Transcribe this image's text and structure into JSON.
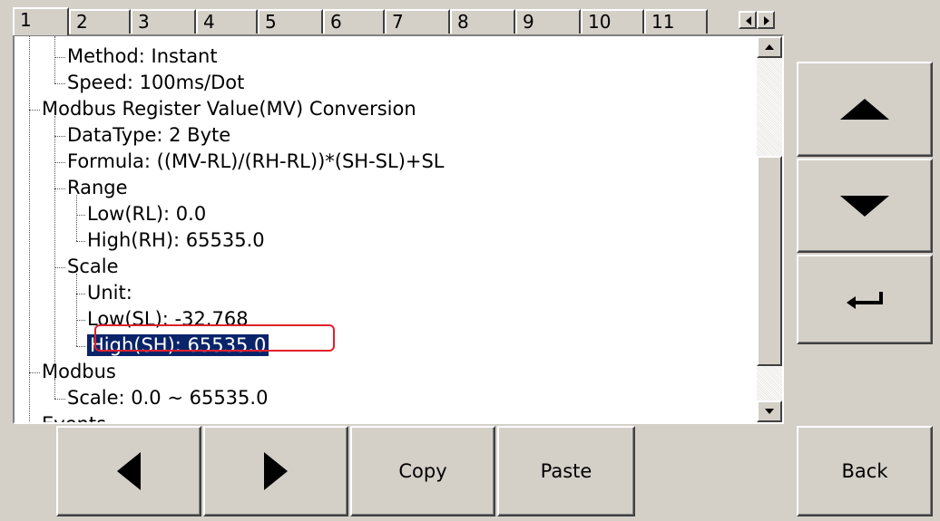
{
  "tabs": [
    "1",
    "2",
    "3",
    "4",
    "5",
    "6",
    "7",
    "8",
    "9",
    "10",
    "11"
  ],
  "tree": [
    {
      "text": "Method: Instant",
      "level": 1
    },
    {
      "text": "Speed: 100ms/Dot",
      "level": 1
    },
    {
      "text": "Modbus Register Value(MV) Conversion",
      "level": 0
    },
    {
      "text": "DataType: 2 Byte",
      "level": 1
    },
    {
      "text": "Formula: ((MV-RL)/(RH-RL))*(SH-SL)+SL",
      "level": 1
    },
    {
      "text": "Range",
      "level": 1
    },
    {
      "text": "Low(RL): 0.0",
      "level": 2
    },
    {
      "text": "High(RH): 65535.0",
      "level": 2
    },
    {
      "text": "Scale",
      "level": 1
    },
    {
      "text": "Unit:",
      "level": 2
    },
    {
      "text": "Low(SL): -32.768",
      "level": 2
    },
    {
      "text": "High(SH): 65535.0",
      "level": 2,
      "selected": true
    },
    {
      "text": "Modbus",
      "level": 0
    },
    {
      "text": "Scale: 0.0 ~ 65535.0",
      "level": 1
    },
    {
      "text": "Events",
      "level": 0
    }
  ],
  "buttons": {
    "up_icon": "up-arrow-icon",
    "down_icon": "down-arrow-icon",
    "enter_icon": "enter-arrow-icon",
    "prev_icon": "left-arrow-icon",
    "next_icon": "right-arrow-icon",
    "copy": "Copy",
    "paste": "Paste",
    "back": "Back"
  },
  "colors": {
    "selection": "#0a246a",
    "highlight_border": "#e0202c",
    "face": "#d4d0c8"
  }
}
